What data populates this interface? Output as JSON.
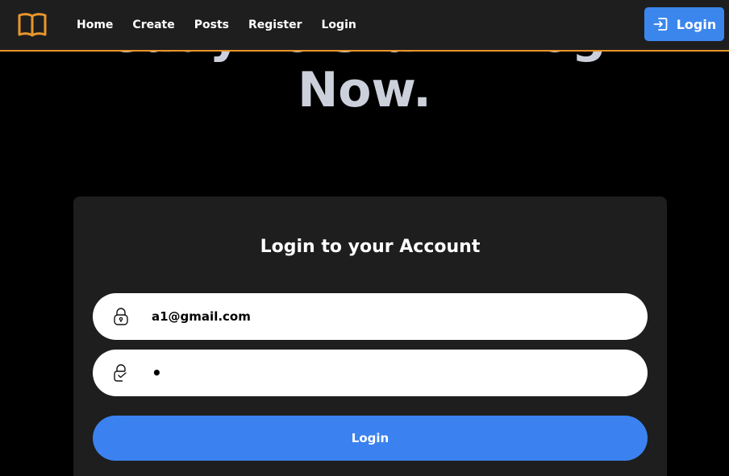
{
  "hero": {
    "line1": "Ready to start? Login",
    "line2": "Now."
  },
  "navbar": {
    "brand_icon": "open-book-icon",
    "links": [
      "Home",
      "Create",
      "Posts",
      "Register",
      "Login"
    ],
    "login_button": "Login",
    "login_icon": "sign-in-icon",
    "accent_color": "#e9962b",
    "button_color": "#3b86ed"
  },
  "card": {
    "title": "Login to your Account",
    "email": {
      "icon": "lock-icon",
      "value": "a1@gmail.com"
    },
    "password": {
      "icon": "lock-check-icon",
      "value": "•"
    },
    "submit_label": "Login",
    "submit_color": "#3b82f0"
  }
}
